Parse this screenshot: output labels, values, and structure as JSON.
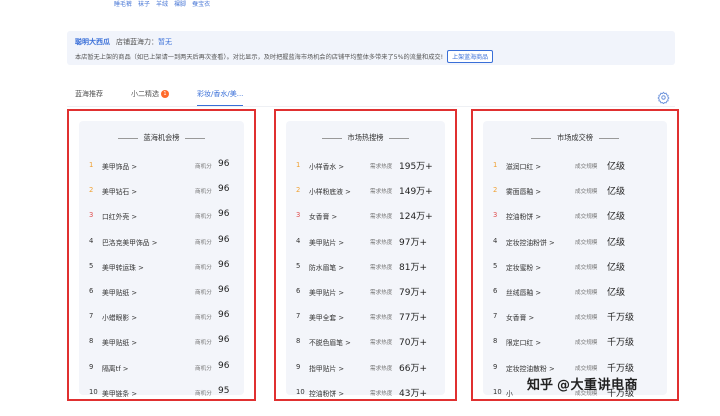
{
  "top_links": [
    "睡毛裤",
    "袜子",
    "羊绒",
    "裸脚",
    "蚕宝衣"
  ],
  "banner": {
    "shop_name": "聪明大西瓜",
    "capacity_label": "店铺蓝海力：",
    "capacity_value": "暂无",
    "description": "本店暂无上架的商品（如已上架请一到两天后再次查看）。对比显示，及时把握蓝海市场机会的店铺平均整体多带来了5%的流量和成交!",
    "button_label": "上架蓝海商品"
  },
  "tabs": [
    {
      "label": "蓝海推荐",
      "active": false
    },
    {
      "label": "小二精选",
      "badge": "1",
      "active": false
    },
    {
      "label": "彩妆/香水/美...",
      "active": true
    }
  ],
  "panels": [
    {
      "title": "蓝海机会榜",
      "metric_label": "商机分",
      "items": [
        {
          "rank": "1",
          "name": "美甲饰品 >",
          "value": "96"
        },
        {
          "rank": "2",
          "name": "美甲钻石 >",
          "value": "96"
        },
        {
          "rank": "3",
          "name": "口红外壳 >",
          "value": "96"
        },
        {
          "rank": "4",
          "name": "巴洛克美甲饰品 >",
          "value": "96"
        },
        {
          "rank": "5",
          "name": "美甲转运珠 >",
          "value": "96"
        },
        {
          "rank": "6",
          "name": "美甲贴纸 >",
          "value": "96"
        },
        {
          "rank": "7",
          "name": "小蜡眼影 >",
          "value": "96"
        },
        {
          "rank": "8",
          "name": "美甲贴纸 >",
          "value": "96"
        },
        {
          "rank": "9",
          "name": "隔离tf >",
          "value": "96"
        },
        {
          "rank": "10",
          "name": "美甲链条 >",
          "value": "95"
        }
      ]
    },
    {
      "title": "市场热搜榜",
      "metric_label": "需求热度",
      "items": [
        {
          "rank": "1",
          "name": "小样香水 >",
          "value": "195万+"
        },
        {
          "rank": "2",
          "name": "小样粉底液 >",
          "value": "149万+"
        },
        {
          "rank": "3",
          "name": "女香膏 >",
          "value": "124万+"
        },
        {
          "rank": "4",
          "name": "美甲贴片 >",
          "value": "97万+"
        },
        {
          "rank": "5",
          "name": "防水眉笔 >",
          "value": "81万+"
        },
        {
          "rank": "6",
          "name": "美甲贴片 >",
          "value": "79万+"
        },
        {
          "rank": "7",
          "name": "美甲全套 >",
          "value": "77万+"
        },
        {
          "rank": "8",
          "name": "不脱色眉笔 >",
          "value": "70万+"
        },
        {
          "rank": "9",
          "name": "指甲贴片 >",
          "value": "66万+"
        },
        {
          "rank": "10",
          "name": "控油粉饼 >",
          "value": "43万+"
        }
      ]
    },
    {
      "title": "市场成交榜",
      "metric_label": "成交规模",
      "items": [
        {
          "rank": "1",
          "name": "滋润口红 >",
          "value": "亿级"
        },
        {
          "rank": "2",
          "name": "雾面唇釉 >",
          "value": "亿级"
        },
        {
          "rank": "3",
          "name": "控油粉饼 >",
          "value": "亿级"
        },
        {
          "rank": "4",
          "name": "定妆控油粉饼 >",
          "value": "亿级"
        },
        {
          "rank": "5",
          "name": "定妆蜜粉 >",
          "value": "亿级"
        },
        {
          "rank": "6",
          "name": "丝绒唇釉 >",
          "value": "亿级"
        },
        {
          "rank": "7",
          "name": "女香膏 >",
          "value": "千万级"
        },
        {
          "rank": "8",
          "name": "限定口红 >",
          "value": "千万级"
        },
        {
          "rank": "9",
          "name": "定妆控油散粉 >",
          "value": "千万级"
        },
        {
          "rank": "10",
          "name": "小",
          "value": "千万级"
        }
      ]
    }
  ],
  "watermark": {
    "icon_text": "知乎",
    "author": "@大重讲电商"
  }
}
